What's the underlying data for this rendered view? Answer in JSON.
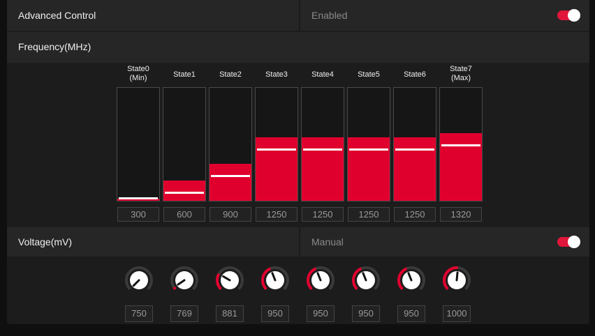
{
  "advanced": {
    "label": "Advanced Control",
    "status": "Enabled",
    "toggle_on": true
  },
  "frequency": {
    "label": "Frequency(MHz)",
    "states": [
      {
        "name": "State0\n(Min)",
        "value": "300",
        "level": 0.02
      },
      {
        "name": "State1",
        "value": "600",
        "level": 0.18
      },
      {
        "name": "State2",
        "value": "900",
        "level": 0.33
      },
      {
        "name": "State3",
        "value": "1250",
        "level": 0.56
      },
      {
        "name": "State4",
        "value": "1250",
        "level": 0.56
      },
      {
        "name": "State5",
        "value": "1250",
        "level": 0.56
      },
      {
        "name": "State6",
        "value": "1250",
        "level": 0.56
      },
      {
        "name": "State7\n(Max)",
        "value": "1320",
        "level": 0.6
      }
    ]
  },
  "voltage": {
    "label": "Voltage(mV)",
    "mode": "Manual",
    "toggle_on": true,
    "knobs": [
      {
        "value": "750",
        "level": 0.0
      },
      {
        "value": "769",
        "level": 0.04
      },
      {
        "value": "881",
        "level": 0.28
      },
      {
        "value": "950",
        "level": 0.42
      },
      {
        "value": "950",
        "level": 0.42
      },
      {
        "value": "950",
        "level": 0.42
      },
      {
        "value": "950",
        "level": 0.42
      },
      {
        "value": "1000",
        "level": 0.52
      }
    ]
  },
  "colors": {
    "accent": "#e0002e",
    "panel": "#1c1c1c",
    "header": "#262626"
  }
}
